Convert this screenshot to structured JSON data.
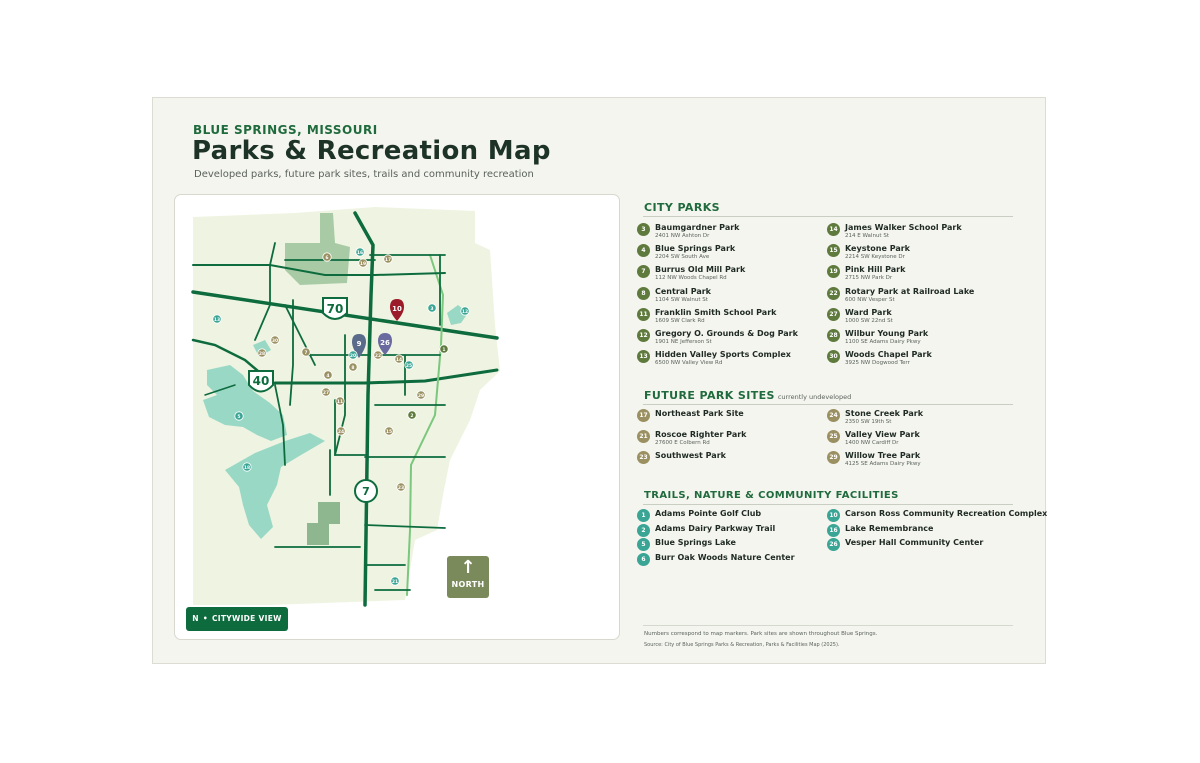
{
  "header": {
    "eyebrow": "BLUE SPRINGS, MISSOURI",
    "title": "Parks & Recreation Map",
    "subtitle": "Developed parks, future park sites, trails and community recreation"
  },
  "colors": {
    "city_park": "#5f7a3d",
    "future_site": "#9a9061",
    "trail_facility": "#3aa595",
    "road": "#0d6b3e",
    "trail": "#7ac77d",
    "water": "#9ad8c6",
    "land": "#eef4e1",
    "park_area": "#a8cba6",
    "pin_red": "#9b1b2a",
    "pin_blue": "#5a6a8a"
  },
  "map": {
    "highway_labels": [
      "70",
      "40",
      "7"
    ],
    "pins": [
      "10",
      "9",
      "26"
    ],
    "markers": [
      {
        "n": "6",
        "type": "future"
      },
      {
        "n": "16",
        "type": "trail"
      },
      {
        "n": "19",
        "type": "future"
      },
      {
        "n": "17",
        "type": "future"
      },
      {
        "n": "3",
        "type": "trail"
      },
      {
        "n": "12",
        "type": "trail"
      },
      {
        "n": "1",
        "type": "park"
      },
      {
        "n": "13",
        "type": "trail"
      },
      {
        "n": "30",
        "type": "future"
      },
      {
        "n": "28",
        "type": "future"
      },
      {
        "n": "7",
        "type": "future"
      },
      {
        "n": "20",
        "type": "trail"
      },
      {
        "n": "8",
        "type": "future"
      },
      {
        "n": "22",
        "type": "future"
      },
      {
        "n": "14",
        "type": "future"
      },
      {
        "n": "25",
        "type": "trail"
      },
      {
        "n": "4",
        "type": "future"
      },
      {
        "n": "27",
        "type": "future"
      },
      {
        "n": "11",
        "type": "future"
      },
      {
        "n": "29",
        "type": "future"
      },
      {
        "n": "5",
        "type": "trail"
      },
      {
        "n": "24",
        "type": "future"
      },
      {
        "n": "15",
        "type": "future"
      },
      {
        "n": "2",
        "type": "park"
      },
      {
        "n": "18",
        "type": "trail"
      },
      {
        "n": "23",
        "type": "future"
      },
      {
        "n": "21",
        "type": "trail"
      }
    ],
    "north_arrow": "↑",
    "north_label": "NORTH",
    "view_badge": {
      "n": "N",
      "sep": "•",
      "label": "CITYWIDE VIEW"
    }
  },
  "city_parks": {
    "title": "CITY PARKS",
    "items": [
      {
        "n": "3",
        "name": "Baumgardner Park",
        "addr": "2401 NW Ashton Dr"
      },
      {
        "n": "4",
        "name": "Blue Springs Park",
        "addr": "2204 SW South Ave"
      },
      {
        "n": "7",
        "name": "Burrus Old Mill Park",
        "addr": "112 NW Woods Chapel Rd"
      },
      {
        "n": "8",
        "name": "Central Park",
        "addr": "1104 SW Walnut St"
      },
      {
        "n": "11",
        "name": "Franklin Smith School Park",
        "addr": "1609 SW Clark Rd"
      },
      {
        "n": "12",
        "name": "Gregory O. Grounds & Dog Park",
        "addr": "1901 NE Jefferson St"
      },
      {
        "n": "13",
        "name": "Hidden Valley Sports Complex",
        "addr": "6500 NW Valley View Rd"
      },
      {
        "n": "14",
        "name": "James Walker School Park",
        "addr": "214 E Walnut St"
      },
      {
        "n": "15",
        "name": "Keystone Park",
        "addr": "2214 SW Keystone Dr"
      },
      {
        "n": "19",
        "name": "Pink Hill Park",
        "addr": "2715 NW Park Dr"
      },
      {
        "n": "22",
        "name": "Rotary Park at Railroad Lake",
        "addr": "600 NW Vesper St"
      },
      {
        "n": "27",
        "name": "Ward Park",
        "addr": "1000 SW 22nd St"
      },
      {
        "n": "28",
        "name": "Wilbur Young Park",
        "addr": "1100 SE Adams Dairy Pkwy"
      },
      {
        "n": "30",
        "name": "Woods Chapel Park",
        "addr": "3925 NW Dogwood Terr"
      }
    ]
  },
  "future_sites": {
    "title": "FUTURE PARK SITES",
    "note": "currently undeveloped",
    "items": [
      {
        "n": "17",
        "name": "Northeast Park Site",
        "addr": ""
      },
      {
        "n": "21",
        "name": "Roscoe Righter Park",
        "addr": "27600 E Colbern Rd"
      },
      {
        "n": "23",
        "name": "Southwest Park",
        "addr": ""
      },
      {
        "n": "24",
        "name": "Stone Creek Park",
        "addr": "2350 SW 19th St"
      },
      {
        "n": "25",
        "name": "Valley View Park",
        "addr": "1400 NW Cardiff Dr"
      },
      {
        "n": "29",
        "name": "Willow Tree Park",
        "addr": "4125 SE Adams Dairy Pkwy"
      }
    ]
  },
  "facilities": {
    "title": "TRAILS, NATURE & COMMUNITY FACILITIES",
    "items": [
      {
        "n": "1",
        "name": "Adams Pointe Golf Club"
      },
      {
        "n": "2",
        "name": "Adams Dairy Parkway Trail"
      },
      {
        "n": "5",
        "name": "Blue Springs Lake"
      },
      {
        "n": "6",
        "name": "Burr Oak Woods Nature Center"
      },
      {
        "n": "10",
        "name": "Carson Ross Community Recreation Complex"
      },
      {
        "n": "16",
        "name": "Lake Remembrance"
      },
      {
        "n": "26",
        "name": "Vesper Hall Community Center"
      }
    ]
  },
  "footer": {
    "line1": "Numbers correspond to map markers. Park sites are shown throughout Blue Springs.",
    "line2": "Source: City of Blue Springs Parks & Recreation, Parks & Facilities Map (2025)."
  }
}
